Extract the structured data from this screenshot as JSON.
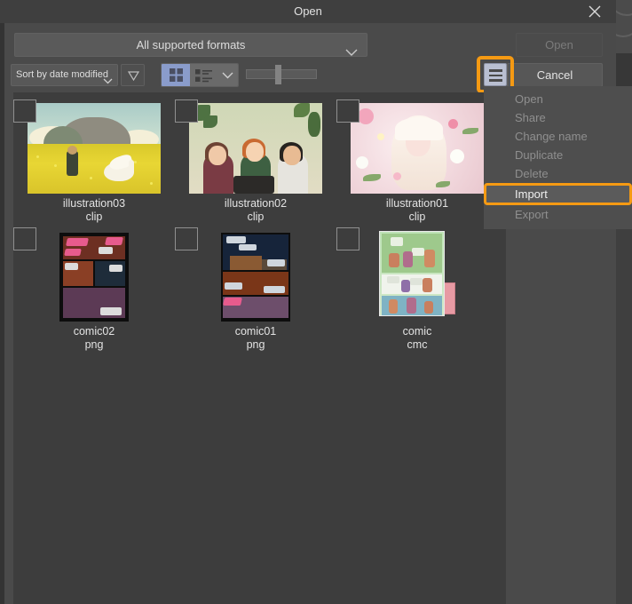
{
  "window": {
    "title": "Open",
    "close_icon": "close-icon"
  },
  "toolbar": {
    "format_filter": {
      "label": "All supported formats",
      "icon": "chevron-down-icon"
    },
    "open_button": "Open",
    "cancel_button": "Cancel",
    "sort_select": {
      "label": "Sort by date modified",
      "icon": "chevron-down-icon"
    },
    "sort_direction_icon": "triangle-down-icon",
    "view_grid_icon": "grid-view-icon",
    "view_list_icon": "list-view-icon",
    "view_chevron_icon": "chevron-down-icon",
    "zoom_slider": {
      "name": "thumbnail-size-slider",
      "value_percent": 45
    },
    "menu_button_icon": "hamburger-menu-icon"
  },
  "context_menu": {
    "items": [
      {
        "label": "Open",
        "enabled": false,
        "highlighted": false
      },
      {
        "label": "Share",
        "enabled": false,
        "highlighted": false
      },
      {
        "label": "Change name",
        "enabled": false,
        "highlighted": false
      },
      {
        "label": "Duplicate",
        "enabled": false,
        "highlighted": false
      },
      {
        "label": "Delete",
        "enabled": false,
        "highlighted": false
      },
      {
        "label": "Import",
        "enabled": true,
        "highlighted": true
      },
      {
        "label": "Export",
        "enabled": false,
        "highlighted": false
      }
    ]
  },
  "files": [
    {
      "name": "illustration03",
      "ext": "clip",
      "checked": false,
      "thumb": "field-goose-mountain"
    },
    {
      "name": "illustration02",
      "ext": "clip",
      "checked": false,
      "thumb": "three-characters-cafe"
    },
    {
      "name": "illustration01",
      "ext": "clip",
      "checked": false,
      "thumb": "floral-portrait"
    },
    {
      "name": "comic02",
      "ext": "png",
      "checked": false,
      "thumb": "comic-page-dark"
    },
    {
      "name": "comic01",
      "ext": "png",
      "checked": false,
      "thumb": "comic-page-night"
    },
    {
      "name": "comic",
      "ext": "cmc",
      "checked": false,
      "thumb": "comic-page-stack"
    }
  ],
  "colors": {
    "highlight": "#f59a13",
    "dialog_bg": "#4a4a4a",
    "filelist_bg": "#3d3d3d",
    "accent_selected": "#8a9ccb"
  }
}
